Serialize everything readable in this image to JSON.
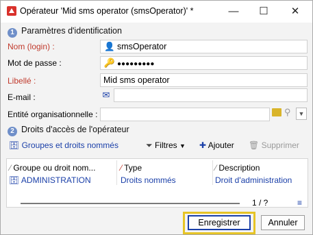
{
  "window": {
    "title": "Opérateur 'Mid sms operator (smsOperator)' *",
    "controls": {
      "minimize": "—",
      "maximize": "☐",
      "close": "✕"
    }
  },
  "section1": {
    "number": "1",
    "title": "Paramètres d'identification"
  },
  "form": {
    "login_label": "Nom (login) :",
    "login_value": "smsOperator",
    "password_label": "Mot de passe :",
    "password_value": "●●●●●●●●●",
    "libelle_label": "Libellé :",
    "libelle_value": "Mid sms operator",
    "email_label": "E-mail :",
    "email_value": "",
    "entity_label": "Entité organisationnelle :",
    "entity_value": ""
  },
  "section2": {
    "number": "2",
    "title": "Droits d'accès de l'opérateur"
  },
  "toolbar": {
    "groups_label": "Groupes et droits nommés",
    "filters_label": "Filtres",
    "add_label": "Ajouter",
    "delete_label": "Supprimer"
  },
  "grid": {
    "columns": [
      "Groupe ou droit nom...",
      "Type",
      "Description"
    ],
    "rows": [
      {
        "name": "ADMINISTRATION",
        "type": "Droits nommés",
        "description": "Droit d'administration"
      }
    ],
    "paging": "1 / ?"
  },
  "buttons": {
    "save": "Enregistrer",
    "cancel": "Annuler"
  },
  "colors": {
    "accent": "#1a3fa8",
    "required": "#c0392b",
    "highlight": "#e6c426"
  }
}
